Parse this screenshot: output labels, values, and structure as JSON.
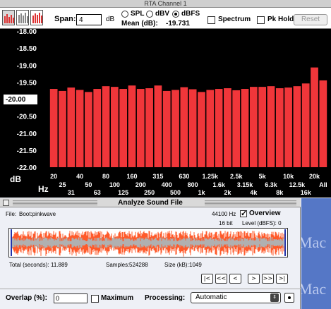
{
  "rta": {
    "title": "RTA Channel 1",
    "span_label": "Span:",
    "span_value": "4",
    "span_unit": "dB",
    "radio_options": [
      {
        "label": "SPL",
        "selected": false
      },
      {
        "label": "dBV",
        "selected": false
      },
      {
        "label": "dBFS",
        "selected": true
      }
    ],
    "mean_label": "Mean (dB):",
    "mean_value": "-19.731",
    "spectrum_label": "Spectrum",
    "spectrum_checked": false,
    "pkhold_label": "Pk Hold",
    "pkhold_checked": false,
    "reset_label": "Reset",
    "db_field_value": "-20.00",
    "db_unit": "dB",
    "hz_unit": "Hz",
    "colors": {
      "bar": "#f0363a",
      "background": "#000000",
      "axis_text": "#ffffff"
    }
  },
  "chart_data": {
    "type": "bar",
    "ylim": [
      -22.0,
      -18.0
    ],
    "y_ticks": [
      "-18.00",
      "-18.50",
      "-19.00",
      "-19.50",
      "-20.00",
      "-20.50",
      "-21.00",
      "-21.50",
      "-22.00"
    ],
    "x_ticks_row1": [
      "20",
      "40",
      "80",
      "160",
      "315",
      "630",
      "1.25k",
      "2.5k",
      "5k",
      "10k",
      "20k"
    ],
    "x_ticks_row2": [
      "25",
      "50",
      "100",
      "200",
      "400",
      "800",
      "1.6k",
      "3.15k",
      "6.3k",
      "12.5k",
      "All"
    ],
    "x_ticks_row3": [
      "31",
      "63",
      "125",
      "250",
      "500",
      "1k",
      "2k",
      "4k",
      "8k",
      "16k"
    ],
    "categories": [
      "20",
      "25",
      "31",
      "40",
      "50",
      "63",
      "80",
      "100",
      "125",
      "160",
      "200",
      "250",
      "315",
      "400",
      "500",
      "630",
      "800",
      "1k",
      "1.25k",
      "1.6k",
      "2k",
      "2.5k",
      "3.15k",
      "4k",
      "5k",
      "6.3k",
      "8k",
      "10k",
      "12.5k",
      "16k",
      "20k",
      "All"
    ],
    "values": [
      -19.7,
      -19.76,
      -19.66,
      -19.73,
      -19.79,
      -19.7,
      -19.62,
      -19.64,
      -19.7,
      -19.6,
      -19.7,
      -19.68,
      -19.6,
      -19.76,
      -19.73,
      -19.65,
      -19.71,
      -19.79,
      -19.73,
      -19.7,
      -19.68,
      -19.74,
      -19.7,
      -19.64,
      -19.64,
      -19.62,
      -19.68,
      -19.66,
      -19.62,
      -19.54,
      -19.07,
      -19.45
    ]
  },
  "analyze": {
    "title": "Analyze Sound File",
    "file_label": "File:",
    "file_name": "Boot:pinkwave",
    "sample_rate": "44100 Hz",
    "overview_label": "Overview",
    "overview_checked": true,
    "bit_depth": "16  bit",
    "level_text": "Level (dBFS):  0",
    "total_label": "Total (seconds):",
    "total_value": "11.889",
    "samples_label": "Samples:",
    "samples_value": "524288",
    "size_label": "Size (kB):",
    "size_value": "1049",
    "nav_buttons": [
      "|<",
      "<<",
      "<",
      ">",
      ">>",
      ">|"
    ],
    "overlap_label": "Overlap (%):",
    "overlap_value": "0",
    "maximum_label": "Maximum",
    "maximum_checked": false,
    "processing_label": "Processing:",
    "processing_value": "Automatic",
    "colors": {
      "wave_fill": "#ff5a2a",
      "wave_core": "#b0b0b0"
    }
  },
  "desktop": {
    "labels": [
      "Mac",
      "Mac"
    ]
  }
}
